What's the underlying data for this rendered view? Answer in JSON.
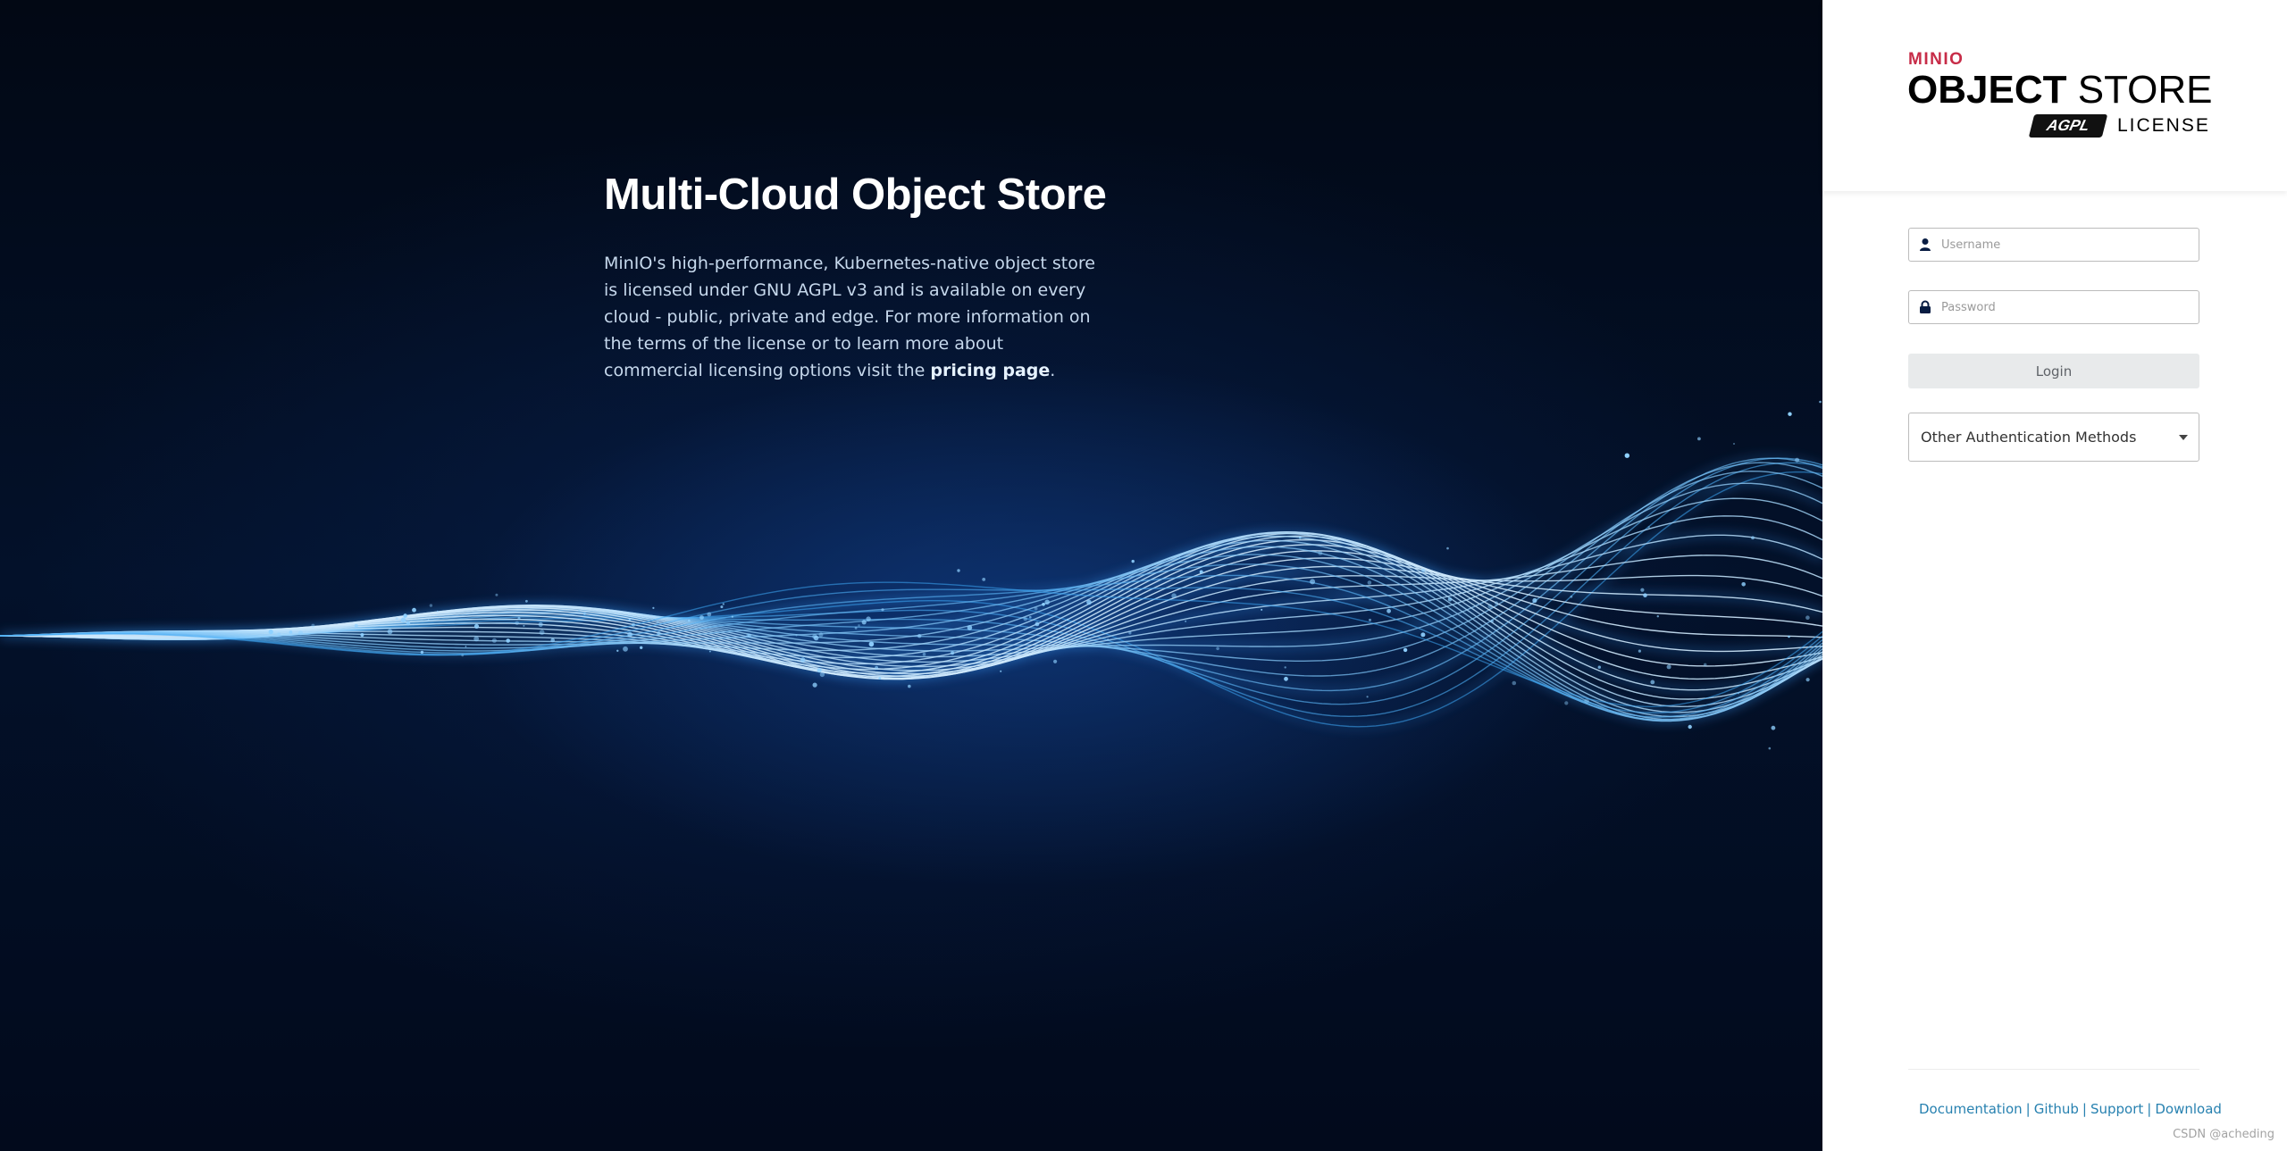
{
  "hero": {
    "title": "Multi-Cloud Object Store",
    "description_before_link": "MinIO's high-performance, Kubernetes-native object store is licensed under GNU AGPL v3 and is available on every cloud - public, private and edge. For more information on the terms of the license or to learn more about commercial licensing options visit the ",
    "link_text": "pricing page",
    "description_after_link": "."
  },
  "logo": {
    "brand": "MINIO",
    "product_bold": "OBJECT",
    "product_thin": "STORE",
    "badge": "AGPL",
    "license_word": "LICENSE"
  },
  "form": {
    "username_placeholder": "Username",
    "username_value": "",
    "password_placeholder": "Password",
    "password_value": "",
    "login_label": "Login",
    "auth_methods_label": "Other Authentication Methods"
  },
  "footer": {
    "links": [
      "Documentation",
      "Github",
      "Support",
      "Download"
    ],
    "separator": "|",
    "watermark": "CSDN @acheding"
  },
  "colors": {
    "brand_red": "#c72c48",
    "link_blue": "#2781b0",
    "hero_background": "#020a1c",
    "wave_blue": "#5ab4ff",
    "button_gray": "#e8eaeb",
    "icon_navy": "#081c42"
  },
  "icons": {
    "username": "user-icon",
    "password": "lock-icon",
    "auth_dropdown": "caret-down-icon"
  }
}
